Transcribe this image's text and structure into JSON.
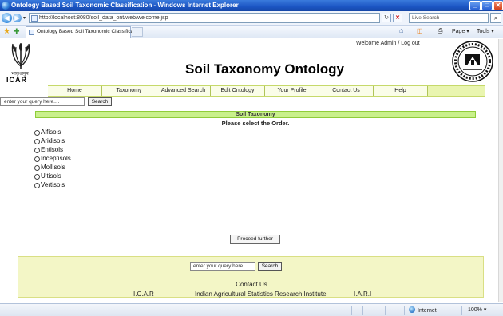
{
  "window": {
    "title": "Ontology Based Soil Taxonomic Classification - Windows Internet Explorer",
    "minimize_glyph": "_",
    "maximize_glyph": "□",
    "close_glyph": "✕"
  },
  "addressbar": {
    "url": "http://localhost:8080/soil_data_ont/web/welcome.jsp",
    "search_text": "Live Search",
    "refresh_glyph": "↻",
    "stop_glyph": "✕",
    "search_glyph": "⌕"
  },
  "tabbar": {
    "tab_label": "Ontology Based Soil Taxonomic Classification",
    "home_glyph": "⌂",
    "feeds_glyph": "◫",
    "print_glyph": "⎙",
    "page_label": "Page ▾",
    "tools_label": "Tools ▾"
  },
  "header": {
    "logo_hindi": "भाकृअनुप",
    "logo_text": "ICAR",
    "title": "Soil Taxonomy Ontology",
    "welcome_prefix": "Welcome Admin / ",
    "logout_label": "Log out"
  },
  "nav": {
    "items": [
      "Home",
      "Taxonomy",
      "Advanced Search",
      "Edit Ontology",
      "Your Profile",
      "Contact Us",
      "Help"
    ]
  },
  "top_search": {
    "placeholder": "enter your query here....",
    "button_label": "Search"
  },
  "main": {
    "section_title": "Soil Taxonomy",
    "prompt": "Please select the Order.",
    "orders": [
      "Alfisols",
      "Aridisols",
      "Entisols",
      "Inceptisols",
      "Mollisols",
      "Ultisols",
      "Vertisols"
    ],
    "proceed_label": "Proceed further"
  },
  "footer": {
    "search_placeholder": "enter your query here....",
    "search_button": "Search",
    "contact_label": "Contact Us",
    "link_icar": "I.C.A.R",
    "link_iasri": "Indian Agricultural Statistics Research Institute",
    "link_iari": "I.A.R.I"
  },
  "statusbar": {
    "zone": "Internet",
    "zoom": "100%  ▾"
  },
  "colors": {
    "accent_green": "#c9f08c",
    "nav_bg": "#e9f5b0",
    "footer_bg": "#f3f6c6",
    "titlebar_blue": "#1b55c4"
  }
}
